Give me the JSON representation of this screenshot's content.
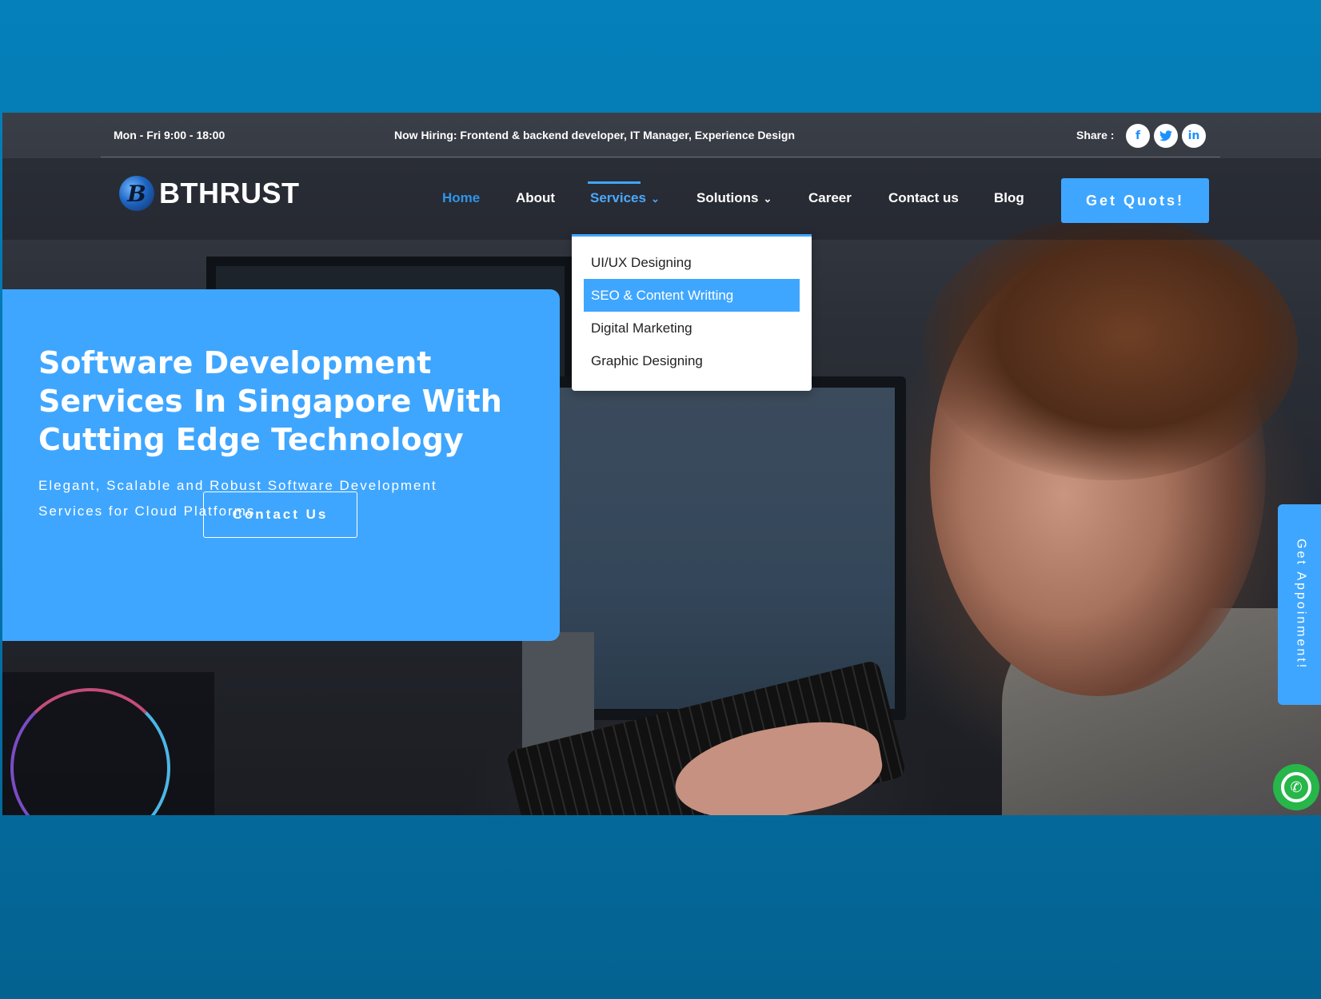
{
  "topbar": {
    "hours": "Mon - Fri 9:00 - 18:00",
    "hiring": "Now Hiring: Frontend & backend developer, IT Manager, Experience Design",
    "share_label": "Share :",
    "social": [
      {
        "icon": "facebook-icon",
        "glyph": "f"
      },
      {
        "icon": "twitter-icon",
        "glyph": "t"
      },
      {
        "icon": "linkedin-icon",
        "glyph": "in"
      }
    ]
  },
  "header": {
    "logo_mark": "B",
    "logo_text": "BTHRUST",
    "nav": {
      "home": "Home",
      "about": "About",
      "services": "Services",
      "solutions": "Solutions",
      "career": "Career",
      "contact": "Contact us",
      "blog": "Blog"
    },
    "chevron": "⌄",
    "cta": "Get Quots!"
  },
  "dropdown": {
    "items": [
      "UI/UX Designing",
      "SEO & Content Writting",
      "Digital Marketing",
      "Graphic Designing"
    ],
    "highlighted_index": 1
  },
  "hero": {
    "title": "Software Development Services In Singapore With Cutting Edge Technology",
    "subtitle": "Elegant, Scalable and Robust Software Development Services for Cloud Platforms",
    "button": "Contact Us"
  },
  "side": {
    "appointment": "Get Appoinment!",
    "whatsapp_icon": "whatsapp-icon",
    "phone_icon": "phone-icon"
  },
  "colors": {
    "accent": "#3fa6ff",
    "outer_background": "#0580ba",
    "whatsapp": "#27b64a"
  }
}
